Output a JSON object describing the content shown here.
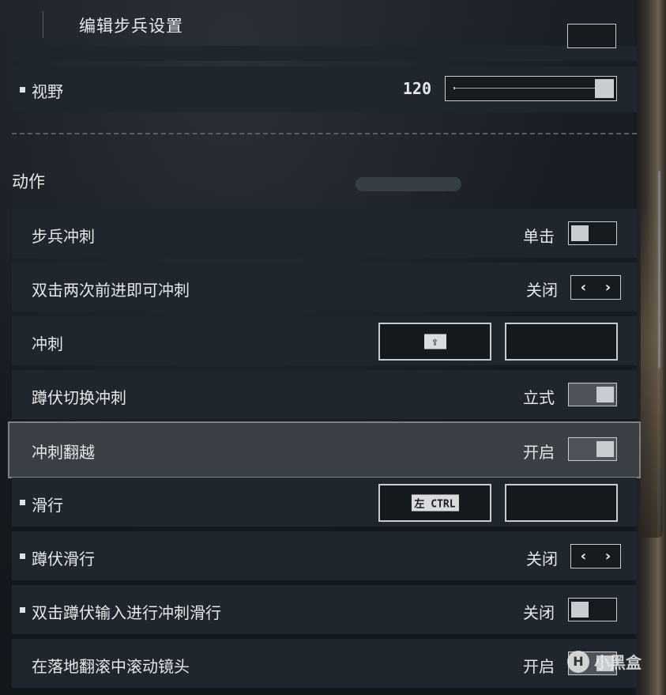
{
  "header": {
    "title": "编辑步兵设置"
  },
  "rows_top": {
    "fov": {
      "label": "视野",
      "value": "120"
    }
  },
  "section": {
    "title": "动作"
  },
  "rows": {
    "infantry_sprint": {
      "label": "步兵冲刺",
      "value": "单击",
      "state": "off"
    },
    "double_tap_sprint": {
      "label": "双击两次前进即可冲刺",
      "value": "关闭",
      "prev": "‹",
      "next": "›"
    },
    "sprint": {
      "label": "冲刺",
      "primary_key": "⇪",
      "secondary_key": ""
    },
    "crouch_toggle_sprint": {
      "label": "蹲伏切换冲刺",
      "value": "立式",
      "state": "on"
    },
    "sprint_vault": {
      "label": "冲刺翻越",
      "value": "开启",
      "state": "on"
    },
    "slide": {
      "label": "滑行",
      "primary_key": "左 CTRL",
      "secondary_key": ""
    },
    "crouch_slide": {
      "label": "蹲伏滑行",
      "value": "关闭",
      "prev": "‹",
      "next": "›"
    },
    "double_tap_crouch_slide": {
      "label": "双击蹲伏输入进行冲刺滑行",
      "value": "关闭",
      "state": "off"
    },
    "roll_camera": {
      "label": "在落地翻滚中滚动镜头",
      "value": "开启",
      "state": "on"
    }
  },
  "watermark": {
    "logo": "H",
    "text": "小黑盒"
  },
  "icons": {
    "sprint_key": "shift-key-icon",
    "stepper_prev": "chevron-left-icon",
    "stepper_next": "chevron-right-icon"
  }
}
